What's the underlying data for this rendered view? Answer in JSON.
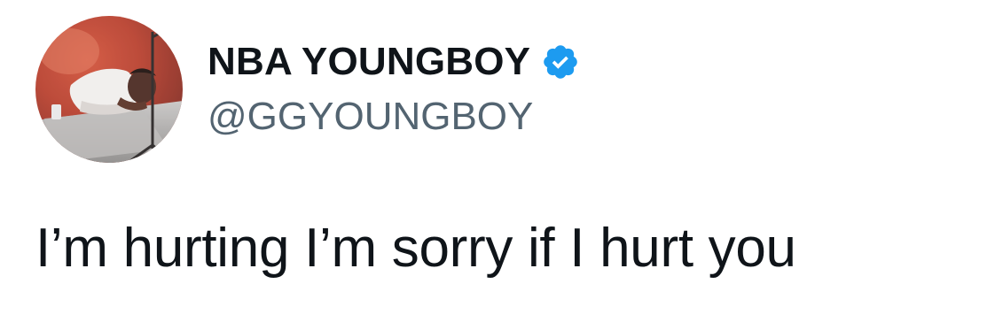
{
  "tweet": {
    "author": {
      "display_name": "NBA YOUNGBOY",
      "handle": "@GGYOUNGBOY",
      "verified": true,
      "avatar_icon": "profile-photo",
      "verified_icon": "verified-badge-icon"
    },
    "text": "I’m hurting I’m sorry if I hurt you"
  },
  "colors": {
    "background": "#ffffff",
    "name": "#0f1419",
    "handle": "#536471",
    "verified": "#1d9bf0",
    "text": "#0f1419"
  }
}
